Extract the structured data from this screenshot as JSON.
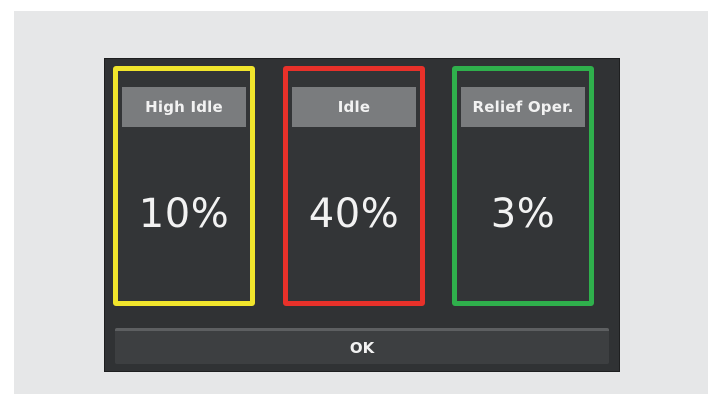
{
  "cards": [
    {
      "label": "High Idle",
      "value": "10%",
      "border_color": "#f1e52c"
    },
    {
      "label": "Idle",
      "value": "40%",
      "border_color": "#e8312a"
    },
    {
      "label": "Relief Oper.",
      "value": "3%",
      "border_color": "#2fb04c"
    }
  ],
  "footer": {
    "ok_label": "OK"
  }
}
